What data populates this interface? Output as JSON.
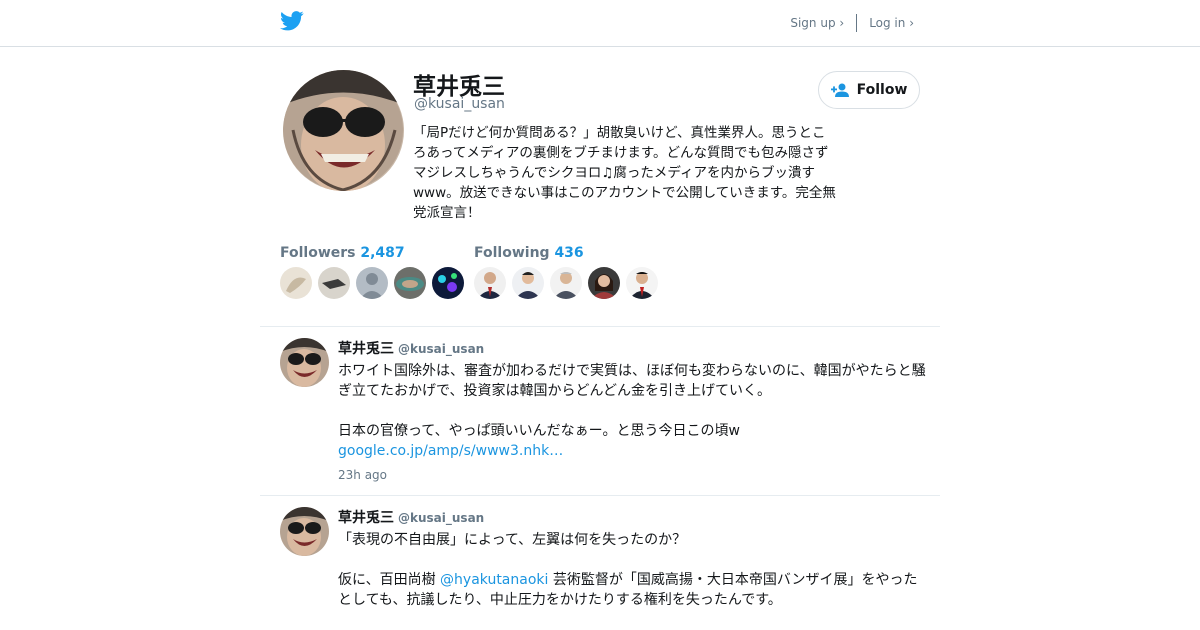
{
  "colors": {
    "accent": "#1b95e0",
    "text": "#14171a",
    "muted": "#657786",
    "border": "#e6ecf0"
  },
  "header": {
    "logo_icon": "twitter-bird-icon",
    "signup_label": "Sign up ›",
    "login_label": "Log in ›"
  },
  "profile": {
    "name": "草井兎三",
    "handle": "@kusai_usan",
    "bio": "「局Pだけど何か質問ある？」胡散臭いけど、真性業界人。思うところあってメディアの裏側をブチまけます。どんな質問でも包み隠さずマジレスしちゃうんでシクヨロ♫腐ったメディアを内からブッ潰すwww。放送できない事はこのアカウントで公開していきます。完全無党派宣言！",
    "follow_label": "Follow",
    "follow_icon": "add-user-icon",
    "followers_label": "Followers",
    "followers_count": "2,487",
    "following_label": "Following",
    "following_count": "436"
  },
  "tweets": [
    {
      "name": "草井兎三",
      "handle": "@kusai_usan",
      "text_1": "ホワイト国除外は、審査が加わるだけで実質は、ほぼ何も変わらないのに、韓国がやたらと騒ぎ立てたおかげで、投資家は韓国からどんどん金を引き上げていく。",
      "text_2": "日本の官僚って、やっぱ頭いいんだなぁー。と思う今日この頃w",
      "link": "google.co.jp/amp/s/www3.nhk…",
      "time": "23h ago"
    },
    {
      "name": "草井兎三",
      "handle": "@kusai_usan",
      "text_1": "「表現の不自由展」によって、左翼は何を失ったのか？",
      "text_2a": "仮に、百田尚樹 ",
      "mention": "@hyakutanaoki",
      "text_2b": " 芸術監督が「国威高揚・大日本帝国バンザイ展」をやったとしても、抗議したり、中止圧力をかけたりする権利を失ったんです。"
    }
  ]
}
